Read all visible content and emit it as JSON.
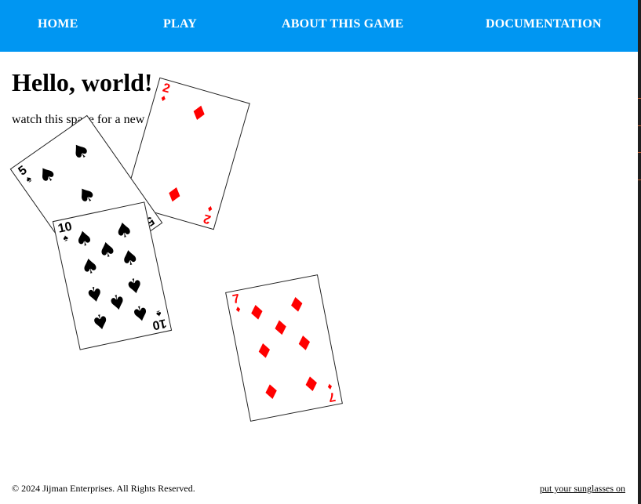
{
  "nav": {
    "items": [
      {
        "label": "HOME"
      },
      {
        "label": "PLAY"
      },
      {
        "label": "ABOUT THIS GAME"
      },
      {
        "label": "DOCUMENTATION"
      }
    ],
    "color": "#0096f2"
  },
  "main": {
    "heading": "Hello, world!",
    "blurb": "watch this space for a new c"
  },
  "cards": [
    {
      "rank": "2",
      "suit_name": "diamonds",
      "suit_glyph": "♦",
      "color": "#ff0000"
    },
    {
      "rank": "5",
      "suit_name": "spades",
      "suit_glyph": "♠",
      "color": "#000000"
    },
    {
      "rank": "10",
      "suit_name": "spades",
      "suit_glyph": "♠",
      "color": "#000000"
    },
    {
      "rank": "7",
      "suit_name": "diamonds",
      "suit_glyph": "♦",
      "color": "#ff0000"
    }
  ],
  "footer": {
    "copyright": "© 2024 Jijman Enterprises. All Rights Reserved.",
    "link": "put your sunglasses on"
  }
}
